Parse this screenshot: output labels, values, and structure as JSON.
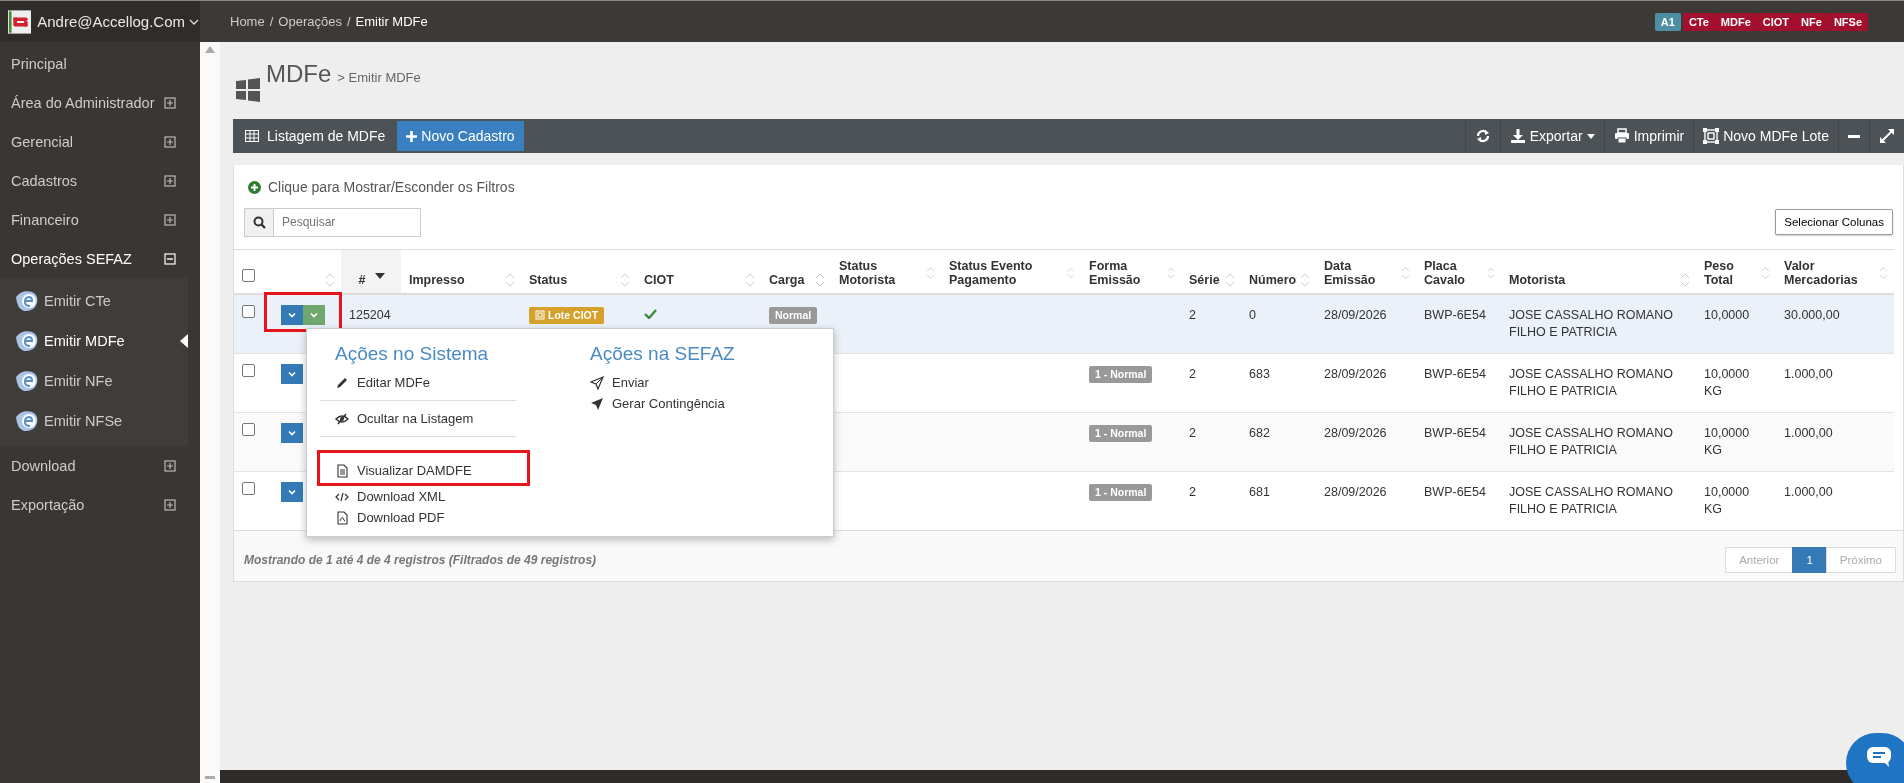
{
  "topbar": {
    "user": "Andre@Accellog.Com",
    "breadcrumb": [
      "Home",
      "Operações",
      "Emitir MDFe"
    ],
    "separator": "/",
    "badges": [
      {
        "label": "A1",
        "color": "#4e8ea2"
      },
      {
        "label": "CTe",
        "color": "#a3102e"
      },
      {
        "label": "MDFe",
        "color": "#a3102e"
      },
      {
        "label": "CIOT",
        "color": "#a3102e"
      },
      {
        "label": "NFe",
        "color": "#a3102e"
      },
      {
        "label": "NFSe",
        "color": "#a3102e"
      }
    ]
  },
  "sidebar": {
    "items": [
      {
        "label": "Principal",
        "expandable": false,
        "expanded": false
      },
      {
        "label": "Área do Administrador",
        "expandable": true,
        "expanded": false
      },
      {
        "label": "Gerencial",
        "expandable": true,
        "expanded": false
      },
      {
        "label": "Cadastros",
        "expandable": true,
        "expanded": false
      },
      {
        "label": "Financeiro",
        "expandable": true,
        "expanded": false
      },
      {
        "label": "Operações SEFAZ",
        "expandable": true,
        "expanded": true,
        "children": [
          {
            "label": "Emitir CTe",
            "selected": false
          },
          {
            "label": "Emitir MDFe",
            "selected": true
          },
          {
            "label": "Emitir NFe",
            "selected": false
          },
          {
            "label": "Emitir NFSe",
            "selected": false
          }
        ]
      },
      {
        "label": "Download",
        "expandable": true,
        "expanded": false
      },
      {
        "label": "Exportação",
        "expandable": true,
        "expanded": false
      }
    ]
  },
  "page": {
    "title": "MDFe",
    "subtitle": "> Emitir MDFe"
  },
  "panel": {
    "title": "Listagem de MDFe",
    "new_button": "Novo Cadastro",
    "tools": [
      {
        "kind": "refresh"
      },
      {
        "kind": "export",
        "label": "Exportar"
      },
      {
        "kind": "print",
        "label": "Imprimir"
      },
      {
        "kind": "batch",
        "label": "Novo MDFe Lote"
      },
      {
        "kind": "minimize"
      },
      {
        "kind": "expand"
      }
    ]
  },
  "filters_link": "Clique para Mostrar/Esconder os Filtros",
  "search": {
    "placeholder": "Pesquisar"
  },
  "columns_button": "Selecionar Colunas",
  "table": {
    "columns": [
      {
        "kind": "checkbox",
        "checked": false
      },
      {
        "kind": "actions",
        "sorted": false
      },
      {
        "kind": "text",
        "label": "#",
        "sorted": true
      },
      {
        "kind": "text",
        "label": "Impresso",
        "sorted": false
      },
      {
        "kind": "text",
        "label": "Status",
        "sorted": false
      },
      {
        "kind": "text",
        "label": "CIOT",
        "sorted": false
      },
      {
        "kind": "text",
        "label": "Carga",
        "sorted": false
      },
      {
        "kind": "text",
        "label": "Status Motorista",
        "sorted": false
      },
      {
        "kind": "text",
        "label": "Status Evento Pagamento",
        "sorted": false
      },
      {
        "kind": "text",
        "label": "Forma Emissão",
        "sorted": false
      },
      {
        "kind": "text",
        "label": "Série",
        "sorted": false
      },
      {
        "kind": "text",
        "label": "Número",
        "sorted": false
      },
      {
        "kind": "text",
        "label": "Data Emissão",
        "sorted": false
      },
      {
        "kind": "text",
        "label": "Placa Cavalo",
        "sorted": false
      },
      {
        "kind": "text",
        "label": "Motorista",
        "sorted": false
      },
      {
        "kind": "text",
        "label": "Peso Total",
        "sorted": false
      },
      {
        "kind": "text",
        "label": "Valor Mercadorias",
        "sorted": false
      }
    ],
    "rows": [
      {
        "selected": true,
        "checked": false,
        "highlighted": true,
        "actions": [
          {
            "color": "#337ab7"
          },
          {
            "color": "#6fa86f"
          }
        ],
        "id": "125204",
        "status_badge": "Lote CIOT",
        "ciot_ok": true,
        "carga": "Normal",
        "serie": "2",
        "numero": "0",
        "data": "28/09/2026",
        "placa": "BWP-6E54",
        "motorista": "JOSE CASSALHO ROMANO FILHO E PATRICIA",
        "peso": "10,0000",
        "valor": "30.000,00"
      },
      {
        "selected": false,
        "checked": false,
        "highlighted": false,
        "actions": [
          {
            "color": "#337ab7"
          }
        ],
        "forma": "1 - Normal",
        "serie": "2",
        "numero": "683",
        "data": "28/09/2026",
        "placa": "BWP-6E54",
        "motorista": "JOSE CASSALHO ROMANO FILHO E PATRICIA",
        "peso": "10,0000 KG",
        "valor": "1.000,00"
      },
      {
        "selected": false,
        "checked": false,
        "highlighted": false,
        "actions": [
          {
            "color": "#337ab7"
          }
        ],
        "forma": "1 - Normal",
        "serie": "2",
        "numero": "682",
        "data": "28/09/2026",
        "placa": "BWP-6E54",
        "motorista": "JOSE CASSALHO ROMANO FILHO E PATRICIA",
        "peso": "10,0000 KG",
        "valor": "1.000,00"
      },
      {
        "selected": false,
        "checked": false,
        "highlighted": false,
        "actions": [
          {
            "color": "#337ab7"
          }
        ],
        "forma": "1 - Normal",
        "serie": "2",
        "numero": "681",
        "data": "28/09/2026",
        "placa": "BWP-6E54",
        "motorista": "JOSE CASSALHO ROMANO FILHO E PATRICIA",
        "peso": "10,0000 KG",
        "valor": "1.000,00"
      }
    ]
  },
  "menu": {
    "sections": [
      {
        "title": "Ações no Sistema",
        "groups": [
          [
            {
              "kind": "pencil",
              "label": "Editar MDFe",
              "highlighted": false
            }
          ],
          [
            {
              "kind": "eye-slash",
              "label": "Ocultar na Listagem",
              "highlighted": false
            }
          ],
          [
            {
              "kind": "file",
              "label": "Visualizar DAMDFE",
              "highlighted": true
            },
            {
              "kind": "code",
              "label": "Download XML",
              "highlighted": false
            },
            {
              "kind": "pdf",
              "label": "Download PDF",
              "highlighted": false
            }
          ]
        ]
      },
      {
        "title": "Ações na SEFAZ",
        "groups": [
          [
            {
              "kind": "send",
              "label": "Enviar",
              "highlighted": false
            },
            {
              "kind": "send-filled",
              "label": "Gerar Contingência",
              "highlighted": false
            }
          ]
        ]
      }
    ]
  },
  "footer": {
    "info": "Mostrando de 1 até 4 de 4 registros (Filtrados de 49 registros)",
    "pages": [
      {
        "label": "Anterior",
        "selected": false,
        "disabled": true
      },
      {
        "label": "1",
        "selected": true,
        "disabled": false
      },
      {
        "label": "Próximo",
        "selected": false,
        "disabled": true
      }
    ]
  }
}
